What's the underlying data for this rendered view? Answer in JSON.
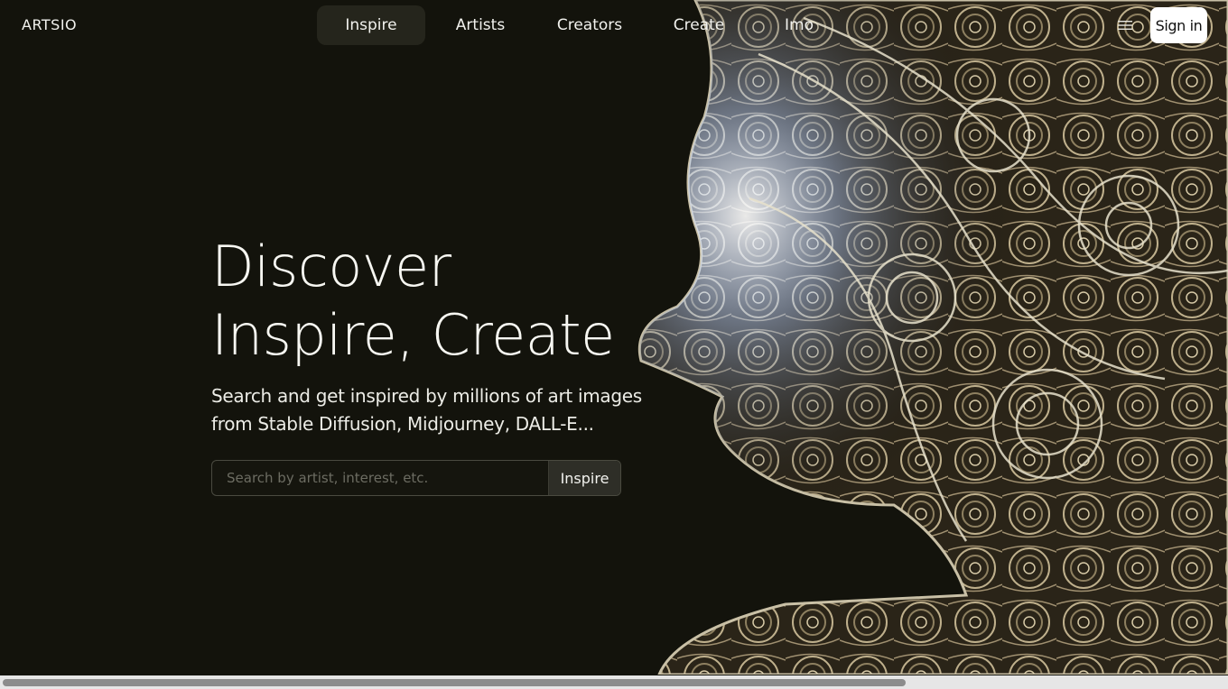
{
  "header": {
    "logo": "ARTSIO",
    "nav": [
      "Inspire",
      "Artists",
      "Creators",
      "Create",
      "Imo"
    ],
    "active_nav": "Inspire",
    "menu_icon": "hamburger-icon",
    "signin_label": "Sign in"
  },
  "hero": {
    "title_line1": "Discover",
    "title_line2": "Inspire, Create",
    "subtitle_line1": "Search and get inspired by millions of art images",
    "subtitle_line2": "from Stable Diffusion, Midjourney, DALL-E...",
    "search_placeholder": "Search by artist, interest, etc.",
    "search_button": "Inspire"
  },
  "colors": {
    "background": "#13130c",
    "active_nav_bg": "#25251c",
    "signin_bg": "#ffffff"
  }
}
